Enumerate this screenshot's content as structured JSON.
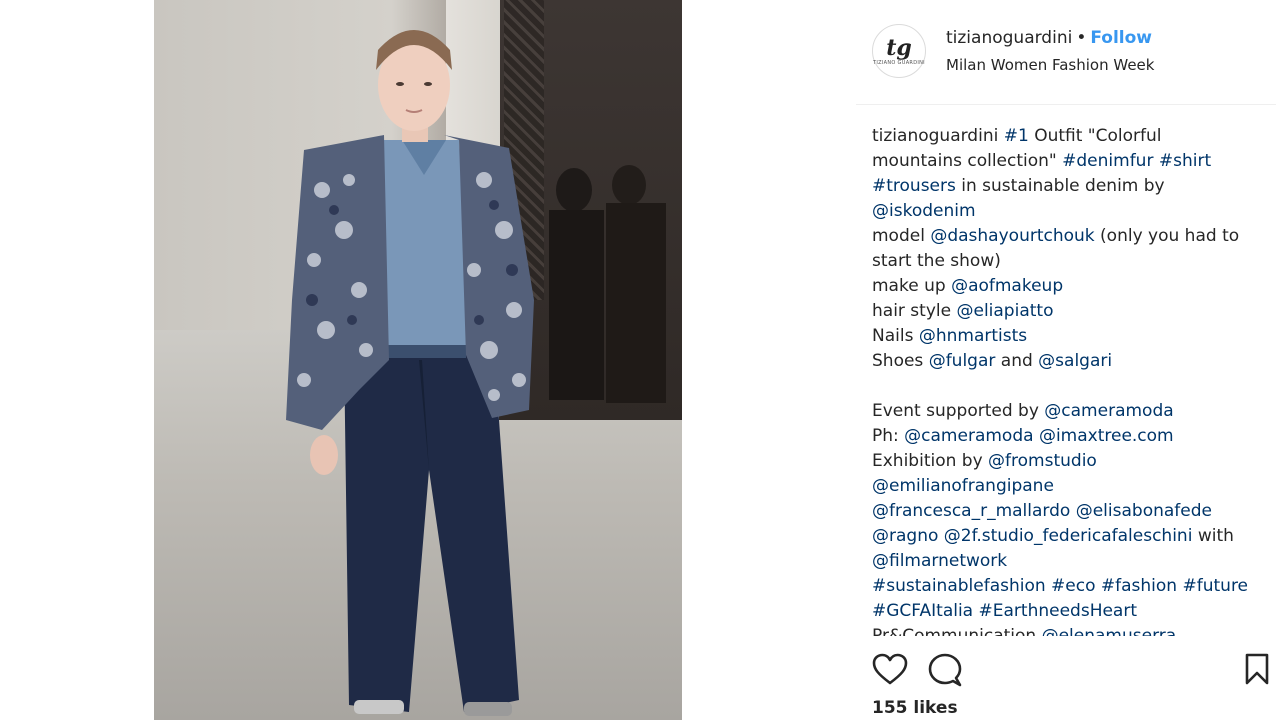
{
  "post": {
    "username": "tizianoguardini",
    "separator": "•",
    "follow_label": "Follow",
    "location": "Milan Women Fashion Week",
    "avatar_brand": "TIZIANO GUARDINI",
    "likes": "155 likes"
  },
  "caption": {
    "lines": [
      [
        {
          "t": "tizianoguardini",
          "k": "user"
        },
        {
          "t": " "
        },
        {
          "t": "#1",
          "k": "link"
        },
        {
          "t": " Outfit \"Colorful"
        }
      ],
      [
        {
          "t": "mountains collection\" "
        },
        {
          "t": "#denimfur",
          "k": "link"
        },
        {
          "t": " "
        },
        {
          "t": "#shirt",
          "k": "link"
        }
      ],
      [
        {
          "t": "#trousers",
          "k": "link"
        },
        {
          "t": " in sustainable denim by"
        }
      ],
      [
        {
          "t": "@iskodenim",
          "k": "link"
        }
      ],
      [
        {
          "t": "model "
        },
        {
          "t": "@dashayourtchouk",
          "k": "link"
        },
        {
          "t": " (only you had to"
        }
      ],
      [
        {
          "t": "start the show)"
        }
      ],
      [
        {
          "t": "make up "
        },
        {
          "t": "@aofmakeup",
          "k": "link"
        }
      ],
      [
        {
          "t": "hair style "
        },
        {
          "t": "@eliapiatto",
          "k": "link"
        }
      ],
      [
        {
          "t": "Nails "
        },
        {
          "t": "@hnmartists",
          "k": "link"
        }
      ],
      [
        {
          "t": "Shoes "
        },
        {
          "t": "@fulgar",
          "k": "link"
        },
        {
          "t": " and "
        },
        {
          "t": "@salgari",
          "k": "link"
        }
      ],
      [],
      [
        {
          "t": "Event supported by "
        },
        {
          "t": "@cameramoda",
          "k": "link"
        }
      ],
      [
        {
          "t": "Ph: "
        },
        {
          "t": "@cameramoda",
          "k": "link"
        },
        {
          "t": " "
        },
        {
          "t": "@imaxtree.com",
          "k": "link"
        }
      ],
      [
        {
          "t": "Exhibition by "
        },
        {
          "t": "@fromstudio",
          "k": "link"
        }
      ],
      [
        {
          "t": "@emilianofrangipane",
          "k": "link"
        }
      ],
      [
        {
          "t": "@francesca_r_mallardo",
          "k": "link"
        },
        {
          "t": " "
        },
        {
          "t": "@elisabonafede",
          "k": "link"
        }
      ],
      [
        {
          "t": "@ragno",
          "k": "link"
        },
        {
          "t": " "
        },
        {
          "t": "@2f.studio_federicafaleschini",
          "k": "link"
        },
        {
          "t": " with"
        }
      ],
      [
        {
          "t": "@filmarnetwork",
          "k": "link"
        }
      ],
      [
        {
          "t": "#sustainablefashion",
          "k": "link"
        },
        {
          "t": " "
        },
        {
          "t": "#eco",
          "k": "link"
        },
        {
          "t": " "
        },
        {
          "t": "#fashion",
          "k": "link"
        },
        {
          "t": " "
        },
        {
          "t": "#future",
          "k": "link"
        }
      ],
      [
        {
          "t": "#GCFAItalia",
          "k": "link"
        },
        {
          "t": " "
        },
        {
          "t": "#EarthneedsHeart",
          "k": "link"
        }
      ],
      [
        {
          "t": "Pr&Communication "
        },
        {
          "t": "@elenamuserra",
          "k": "link"
        }
      ]
    ]
  },
  "icons": {
    "like": "heart-icon",
    "comment": "comment-icon",
    "save": "bookmark-icon"
  },
  "colors": {
    "link": "#003569",
    "follow": "#3897f0",
    "text": "#262626"
  }
}
